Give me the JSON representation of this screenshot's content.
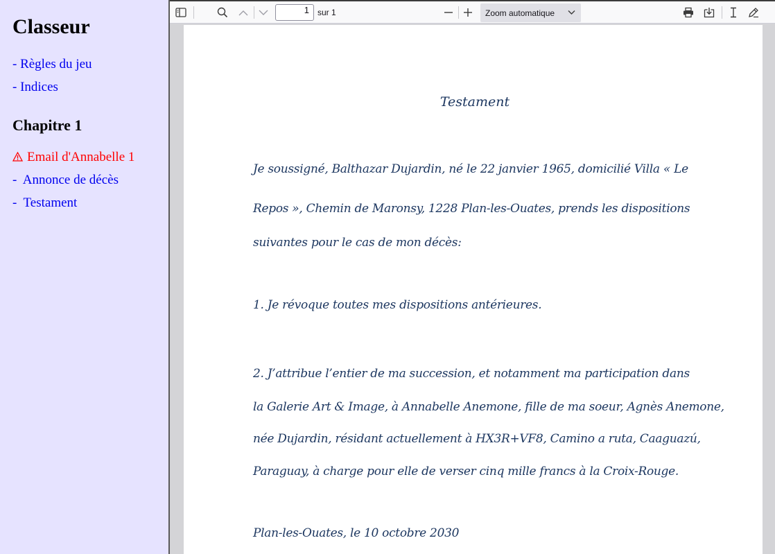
{
  "sidebar": {
    "title": "Classeur",
    "links": [
      "- Règles du jeu",
      "- Indices"
    ],
    "chapter_title": "Chapitre 1",
    "chapter_items": [
      {
        "label": "Email d'Annabelle 1",
        "prefix": "",
        "status_icon": "warning-triangle",
        "color": "#ff0000"
      },
      {
        "label": "Annonce de décès",
        "prefix": "-",
        "color": "#0000ee"
      },
      {
        "label": "Testament",
        "prefix": "-",
        "color": "#0000ee"
      }
    ]
  },
  "toolbar": {
    "page_number": "1",
    "page_count_label": "sur 1",
    "zoom_label": "Zoom automatique",
    "icons": [
      "sidebar-toggle-icon",
      "search-icon",
      "previous-page-icon",
      "next-page-icon",
      "zoom-out-icon",
      "zoom-in-icon",
      "chevron-down-icon",
      "print-icon",
      "download-icon",
      "text-cursor-icon",
      "draw-icon"
    ]
  },
  "document": {
    "title": "Testament",
    "lines": [
      "Je soussigné, Balthazar Dujardin, né le 22 janvier 1965, domicilié Villa « Le",
      "Repos », Chemin de Maronsy, 1228 Plan-les-Ouates, prends les dispositions",
      "suivantes pour le cas de mon décès:",
      "1. Je révoque toutes mes dispositions antérieures.",
      "2. J’attribue l’entier de ma succession, et notamment ma participation dans",
      "la Galerie Art & Image, à Annabelle Anemone, fille de ma soeur, Agnès Anemone,",
      "née Dujardin, résidant actuellement à HX3R+VF8, Camino a ruta, Caaguazú,",
      "Paraguay, à charge pour elle de verser cinq mille francs à la Croix-Rouge.",
      "Plan-les-Ouates, le 10 octobre 2030"
    ]
  },
  "colors": {
    "sidebar_bg": "#e6e3ff",
    "link": "#0000ee",
    "alert": "#ff0000",
    "ink": "#1d3760"
  }
}
